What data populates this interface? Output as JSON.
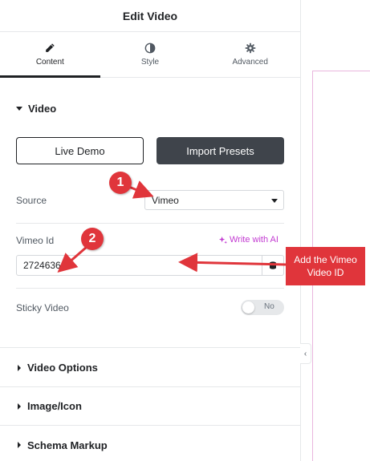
{
  "header": {
    "title": "Edit Video"
  },
  "tabs": [
    {
      "label": "Content",
      "icon": "pencil-icon",
      "active": true
    },
    {
      "label": "Style",
      "icon": "contrast-icon",
      "active": false
    },
    {
      "label": "Advanced",
      "icon": "gear-icon",
      "active": false
    }
  ],
  "video_section": {
    "title": "Video",
    "live_demo_label": "Live Demo",
    "import_presets_label": "Import Presets",
    "source": {
      "label": "Source",
      "value": "Vimeo"
    },
    "vimeo_id": {
      "label": "Vimeo Id",
      "ai_link": "Write with AI",
      "value": "27246366"
    },
    "sticky_video": {
      "label": "Sticky Video",
      "state": "No"
    }
  },
  "collapsed_sections": [
    {
      "title": "Video Options"
    },
    {
      "title": "Image/Icon"
    },
    {
      "title": "Schema Markup"
    }
  ],
  "collapse_handle": "‹",
  "annotations": {
    "marker_1": "1",
    "marker_2": "2",
    "callout": "Add the Vimeo Video ID",
    "accent_color": "#e0353b"
  }
}
